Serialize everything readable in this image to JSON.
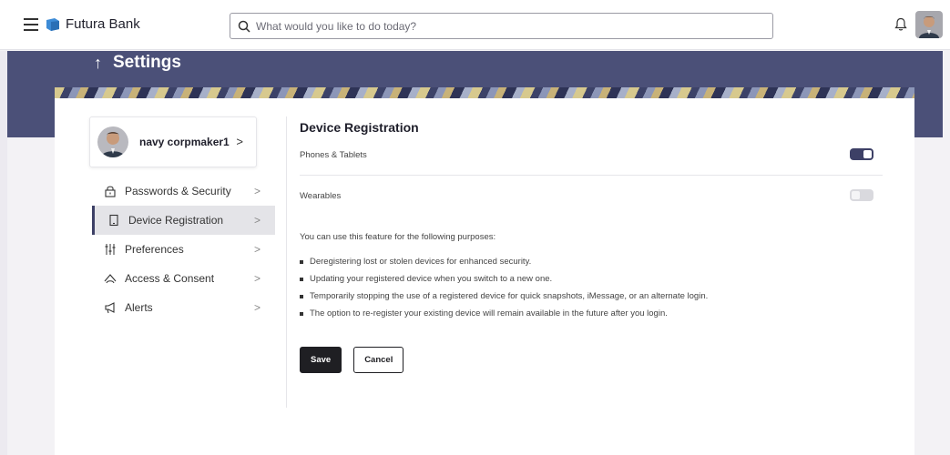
{
  "topbar": {
    "brand": "Futura Bank",
    "search_placeholder": "What would you like to do today?",
    "brand_color": "#3d8bd6"
  },
  "header": {
    "title": "Settings"
  },
  "profile": {
    "name": "navy corpmaker1"
  },
  "menu": {
    "items": [
      {
        "label": "Passwords & Security",
        "icon": "lock-icon",
        "active": false
      },
      {
        "label": "Device Registration",
        "icon": "device-icon",
        "active": true
      },
      {
        "label": "Preferences",
        "icon": "sliders-icon",
        "active": false
      },
      {
        "label": "Access & Consent",
        "icon": "consent-icon",
        "active": false
      },
      {
        "label": "Alerts",
        "icon": "megaphone-icon",
        "active": false
      }
    ]
  },
  "content": {
    "title": "Device Registration",
    "rows": [
      {
        "label": "Phones & Tablets",
        "enabled": true
      },
      {
        "label": "Wearables",
        "enabled": false
      }
    ],
    "intro": "You can use this feature for the following purposes:",
    "purposes": [
      "Deregistering lost or stolen devices for enhanced security.",
      "Updating your registered device when you switch to a new one.",
      "Temporarily stopping the use of a registered device for quick snapshots, iMessage, or an alternate login.",
      "The option to re-register your existing device will remain available in the future after you login."
    ],
    "save_label": "Save",
    "cancel_label": "Cancel"
  },
  "colors": {
    "header_band": "#4b5078",
    "toggle_on": "#3d4066",
    "primary_button": "#1f1f23"
  }
}
